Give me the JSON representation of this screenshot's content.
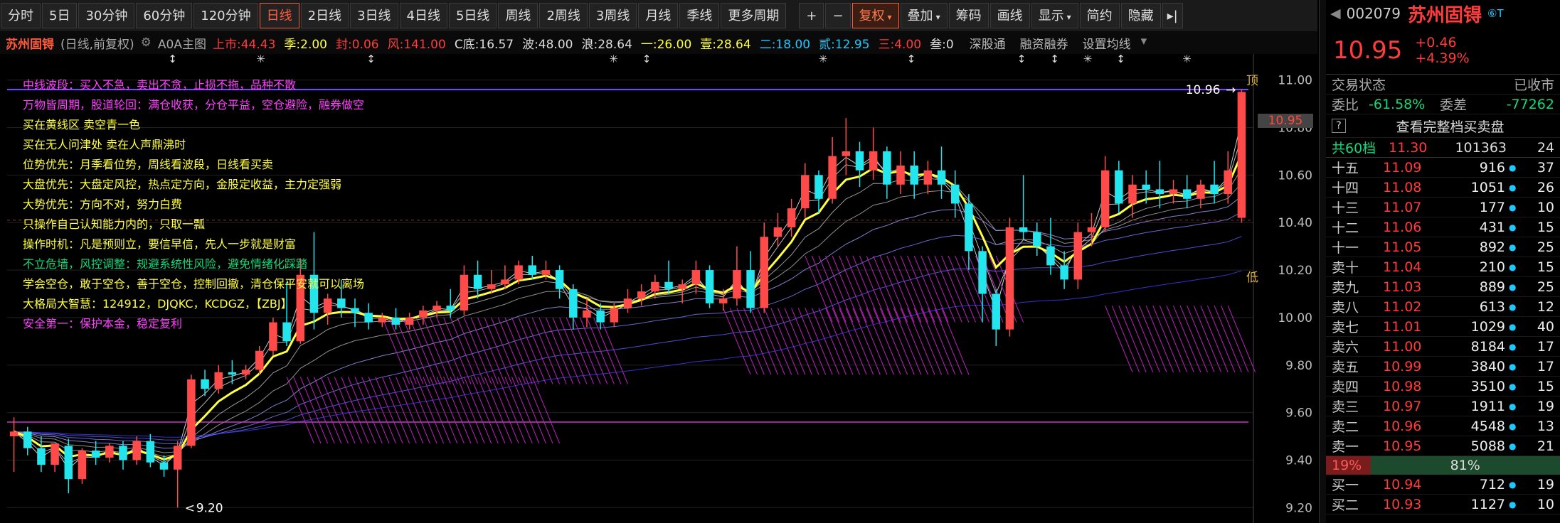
{
  "toolbar": {
    "period_buttons": [
      "分时",
      "5日",
      "30分钟",
      "60分钟",
      "120分钟",
      "日线",
      "2日线",
      "3日线",
      "4日线",
      "5日线",
      "周线",
      "2周线",
      "3周线",
      "月线",
      "季线",
      "更多周期"
    ],
    "active_period": "日线",
    "plus": "+",
    "minus": "−",
    "right_buttons": [
      "复权",
      "叠加",
      "筹码",
      "画线",
      "显示",
      "简约",
      "隐藏"
    ]
  },
  "info_bar": {
    "name": "苏州固锝",
    "mode": "(日线,前复权)",
    "indicator_name": "A0A主图",
    "items": [
      {
        "text": "上市:44.43",
        "color": "#ff3b3b"
      },
      {
        "text": "季:2.00",
        "color": "#ffff40"
      },
      {
        "text": "封:0.06",
        "color": "#ff3b3b"
      },
      {
        "text": "风:141.00",
        "color": "#ff3b3b"
      },
      {
        "text": "C底:16.57",
        "color": "#dddddd"
      },
      {
        "text": "波:48.00",
        "color": "#dddddd"
      },
      {
        "text": "浪:28.64",
        "color": "#dddddd"
      },
      {
        "text": "一:26.00",
        "color": "#ffff40"
      },
      {
        "text": "壹:28.64",
        "color": "#ffff40"
      },
      {
        "text": "二:18.00",
        "color": "#1ec8ff"
      },
      {
        "text": "贰:12.95",
        "color": "#1ec8ff"
      },
      {
        "text": "三:4.00",
        "color": "#ff3b3b"
      },
      {
        "text": "叁:0",
        "color": "#dddddd"
      }
    ],
    "links": [
      "深股通",
      "融资融券",
      "设置均线"
    ]
  },
  "notes": [
    {
      "text": "中线波段：买入不急，卖出不贪，止损不拖，品种不散",
      "color": "#ff40ff"
    },
    {
      "text": "万物皆周期，股道轮回：满仓收获，分仓平益，空仓避险，融券做空",
      "color": "#ff40ff"
    },
    {
      "text": "买在黄线区    卖空青一色",
      "color": "#ffff40"
    },
    {
      "text": "买在无人问津处  卖在人声鼎沸时",
      "color": "#ffff40"
    },
    {
      "text": "位势优先：月季看位势，周线看波段，日线看买卖",
      "color": "#ffff40"
    },
    {
      "text": "大盘优先：大盘定风控，热点定方向，金股定收益，主力定强弱",
      "color": "#ffff40"
    },
    {
      "text": "大势优先：方向不对，努力白费",
      "color": "#ffff40"
    },
    {
      "text": "只操作自己认知能力内的，只取一瓢",
      "color": "#ffff40"
    },
    {
      "text": "操作时机：凡是预则立，要信早信，先人一步就是财富",
      "color": "#ffff40"
    },
    {
      "text": "不立危墙，风控调整：规避系统性风险，避免情绪化踩踏",
      "color": "#14d97a"
    },
    {
      "text": "学会空仓，敢于空仓，善于空仓，控制回撤，清仓保平安就可以离场",
      "color": "#ffff40"
    },
    {
      "text": "大格局大智慧：124912，DJQKC，KCDGZ，【ZBJ】",
      "color": "#ffff40"
    },
    {
      "text": "安全第一：保护本金，稳定复利",
      "color": "#ff40ff"
    }
  ],
  "chart_labels": {
    "top_marker": "顶",
    "low_marker": "低",
    "high_label": "10.96",
    "low_label": "9.20",
    "current_price_tag": "10.95"
  },
  "chart_data": {
    "type": "candlestick",
    "y_ticks": [
      "11.00",
      "10.80",
      "10.60",
      "10.40",
      "10.20",
      "10.00",
      "9.80",
      "9.60",
      "9.40",
      "9.20"
    ],
    "ylim": [
      9.15,
      11.02
    ],
    "candles": [
      [
        9.5,
        9.58,
        9.52,
        9.35
      ],
      [
        9.52,
        9.54,
        9.45,
        9.42
      ],
      [
        9.45,
        9.5,
        9.38,
        9.35
      ],
      [
        9.38,
        9.47,
        9.47,
        9.35
      ],
      [
        9.46,
        9.49,
        9.32,
        9.26
      ],
      [
        9.32,
        9.45,
        9.44,
        9.3
      ],
      [
        9.44,
        9.48,
        9.41,
        9.38
      ],
      [
        9.41,
        9.47,
        9.46,
        9.39
      ],
      [
        9.46,
        9.48,
        9.4,
        9.36
      ],
      [
        9.4,
        9.5,
        9.48,
        9.38
      ],
      [
        9.48,
        9.51,
        9.39,
        9.37
      ],
      [
        9.39,
        9.42,
        9.36,
        9.33
      ],
      [
        9.36,
        9.48,
        9.46,
        9.2
      ],
      [
        9.46,
        9.76,
        9.74,
        9.45
      ],
      [
        9.74,
        9.78,
        9.7,
        9.67
      ],
      [
        9.7,
        9.8,
        9.77,
        9.68
      ],
      [
        9.77,
        9.82,
        9.76,
        9.72
      ],
      [
        9.76,
        9.8,
        9.78,
        9.74
      ],
      [
        9.78,
        9.88,
        9.86,
        9.76
      ],
      [
        9.86,
        10.0,
        9.98,
        9.84
      ],
      [
        9.98,
        10.15,
        9.9,
        9.88
      ],
      [
        9.9,
        10.25,
        10.18,
        9.89
      ],
      [
        10.18,
        10.36,
        10.02,
        9.95
      ],
      [
        10.02,
        10.1,
        10.08,
        9.97
      ],
      [
        10.08,
        10.16,
        10.04,
        10.0
      ],
      [
        10.04,
        10.08,
        10.02,
        9.96
      ],
      [
        10.02,
        10.06,
        9.98,
        9.95
      ],
      [
        9.98,
        10.02,
        10.0,
        9.96
      ],
      [
        10.0,
        10.04,
        9.97,
        9.95
      ],
      [
        9.97,
        10.02,
        10.0,
        9.95
      ],
      [
        10.0,
        10.05,
        10.03,
        9.97
      ],
      [
        10.03,
        10.07,
        10.05,
        10.0
      ],
      [
        10.05,
        10.12,
        10.03,
        10.0
      ],
      [
        10.03,
        10.22,
        10.18,
        10.01
      ],
      [
        10.18,
        10.24,
        10.12,
        10.08
      ],
      [
        10.12,
        10.2,
        10.14,
        10.1
      ],
      [
        10.14,
        10.22,
        10.16,
        10.12
      ],
      [
        10.16,
        10.24,
        10.22,
        10.14
      ],
      [
        10.22,
        10.26,
        10.18,
        10.16
      ],
      [
        10.18,
        10.24,
        10.2,
        10.16
      ],
      [
        10.2,
        10.22,
        10.12,
        10.08
      ],
      [
        10.12,
        10.14,
        10.0,
        9.95
      ],
      [
        10.0,
        10.08,
        10.03,
        9.96
      ],
      [
        10.03,
        10.06,
        9.98,
        9.95
      ],
      [
        9.98,
        10.06,
        10.04,
        9.96
      ],
      [
        10.04,
        10.12,
        10.08,
        10.02
      ],
      [
        10.08,
        10.14,
        10.11,
        10.05
      ],
      [
        10.11,
        10.18,
        10.15,
        10.08
      ],
      [
        10.15,
        10.24,
        10.12,
        10.1
      ],
      [
        10.12,
        10.16,
        10.14,
        10.06
      ],
      [
        10.14,
        10.24,
        10.2,
        10.1
      ],
      [
        10.2,
        10.22,
        10.06,
        10.04
      ],
      [
        10.06,
        10.12,
        10.08,
        10.03
      ],
      [
        10.08,
        10.3,
        10.2,
        10.05
      ],
      [
        10.2,
        10.28,
        10.04,
        10.02
      ],
      [
        10.04,
        10.4,
        10.34,
        10.02
      ],
      [
        10.34,
        10.44,
        10.38,
        10.3
      ],
      [
        10.38,
        10.5,
        10.46,
        10.34
      ],
      [
        10.46,
        10.65,
        10.6,
        10.42
      ],
      [
        10.6,
        10.62,
        10.5,
        10.44
      ],
      [
        10.5,
        10.76,
        10.68,
        10.48
      ],
      [
        10.68,
        10.84,
        10.7,
        10.6
      ],
      [
        10.7,
        10.74,
        10.62,
        10.55
      ],
      [
        10.62,
        10.8,
        10.7,
        10.58
      ],
      [
        10.7,
        10.72,
        10.56,
        10.5
      ],
      [
        10.56,
        10.7,
        10.64,
        10.52
      ],
      [
        10.64,
        10.7,
        10.56,
        10.5
      ],
      [
        10.56,
        10.66,
        10.62,
        10.52
      ],
      [
        10.62,
        10.72,
        10.56,
        10.5
      ],
      [
        10.56,
        10.62,
        10.48,
        10.42
      ],
      [
        10.48,
        10.52,
        10.28,
        10.2
      ],
      [
        10.28,
        10.3,
        10.1,
        9.98
      ],
      [
        10.1,
        10.12,
        9.95,
        9.88
      ],
      [
        9.95,
        10.42,
        10.38,
        9.92
      ],
      [
        10.38,
        10.6,
        10.36,
        10.33
      ],
      [
        10.36,
        10.4,
        10.3,
        10.26
      ],
      [
        10.3,
        10.42,
        10.22,
        10.18
      ],
      [
        10.22,
        10.28,
        10.16,
        10.12
      ],
      [
        10.16,
        10.4,
        10.36,
        10.12
      ],
      [
        10.36,
        10.44,
        10.38,
        10.3
      ],
      [
        10.38,
        10.68,
        10.62,
        10.36
      ],
      [
        10.62,
        10.66,
        10.48,
        10.44
      ],
      [
        10.48,
        10.6,
        10.56,
        10.42
      ],
      [
        10.56,
        10.62,
        10.54,
        10.48
      ],
      [
        10.54,
        10.66,
        10.52,
        10.46
      ],
      [
        10.52,
        10.58,
        10.54,
        10.48
      ],
      [
        10.54,
        10.6,
        10.5,
        10.46
      ],
      [
        10.5,
        10.58,
        10.56,
        10.46
      ],
      [
        10.56,
        10.66,
        10.52,
        10.48
      ],
      [
        10.52,
        10.7,
        10.62,
        10.48
      ],
      [
        10.42,
        10.96,
        10.95,
        10.4
      ]
    ]
  },
  "side_panel": {
    "code": "002079",
    "name": "苏州固锝",
    "badge": "⑥T",
    "price": "10.95",
    "change": "+0.46",
    "change_pct": "+4.39%",
    "trade_status_label": "交易状态",
    "trade_status": "已收市",
    "weibi_label": "委比",
    "weibi": "-61.58%",
    "weicha_label": "委差",
    "weicha": "-77262",
    "help_icon": "?",
    "full_book": "查看完整档买卖盘",
    "total_label": "共60档",
    "total_price": "11.30",
    "total_vol": "101363",
    "total_cnt": "24",
    "asks": [
      {
        "label": "十五",
        "price": "11.09",
        "vol": "916",
        "cnt": "37"
      },
      {
        "label": "十四",
        "price": "11.08",
        "vol": "1051",
        "cnt": "26"
      },
      {
        "label": "十三",
        "price": "11.07",
        "vol": "177",
        "cnt": "10"
      },
      {
        "label": "十二",
        "price": "11.06",
        "vol": "431",
        "cnt": "15"
      },
      {
        "label": "十一",
        "price": "11.05",
        "vol": "892",
        "cnt": "25"
      },
      {
        "label": "卖十",
        "price": "11.04",
        "vol": "210",
        "cnt": "15"
      },
      {
        "label": "卖九",
        "price": "11.03",
        "vol": "889",
        "cnt": "25"
      },
      {
        "label": "卖八",
        "price": "11.02",
        "vol": "613",
        "cnt": "12"
      },
      {
        "label": "卖七",
        "price": "11.01",
        "vol": "1029",
        "cnt": "40"
      },
      {
        "label": "卖六",
        "price": "11.00",
        "vol": "8184",
        "cnt": "17"
      },
      {
        "label": "卖五",
        "price": "10.99",
        "vol": "3840",
        "cnt": "17"
      },
      {
        "label": "卖四",
        "price": "10.98",
        "vol": "3510",
        "cnt": "15"
      },
      {
        "label": "卖三",
        "price": "10.97",
        "vol": "1911",
        "cnt": "19"
      },
      {
        "label": "卖二",
        "price": "10.96",
        "vol": "4548",
        "cnt": "13"
      },
      {
        "label": "卖一",
        "price": "10.95",
        "vol": "5088",
        "cnt": "21"
      }
    ],
    "ratio_buy": "19%",
    "ratio_buy_fraction": 0.19,
    "ratio_sell": "81%",
    "bids": [
      {
        "label": "买一",
        "price": "10.94",
        "vol": "712",
        "cnt": "19"
      },
      {
        "label": "买二",
        "price": "10.93",
        "vol": "1127",
        "cnt": "10"
      }
    ]
  }
}
